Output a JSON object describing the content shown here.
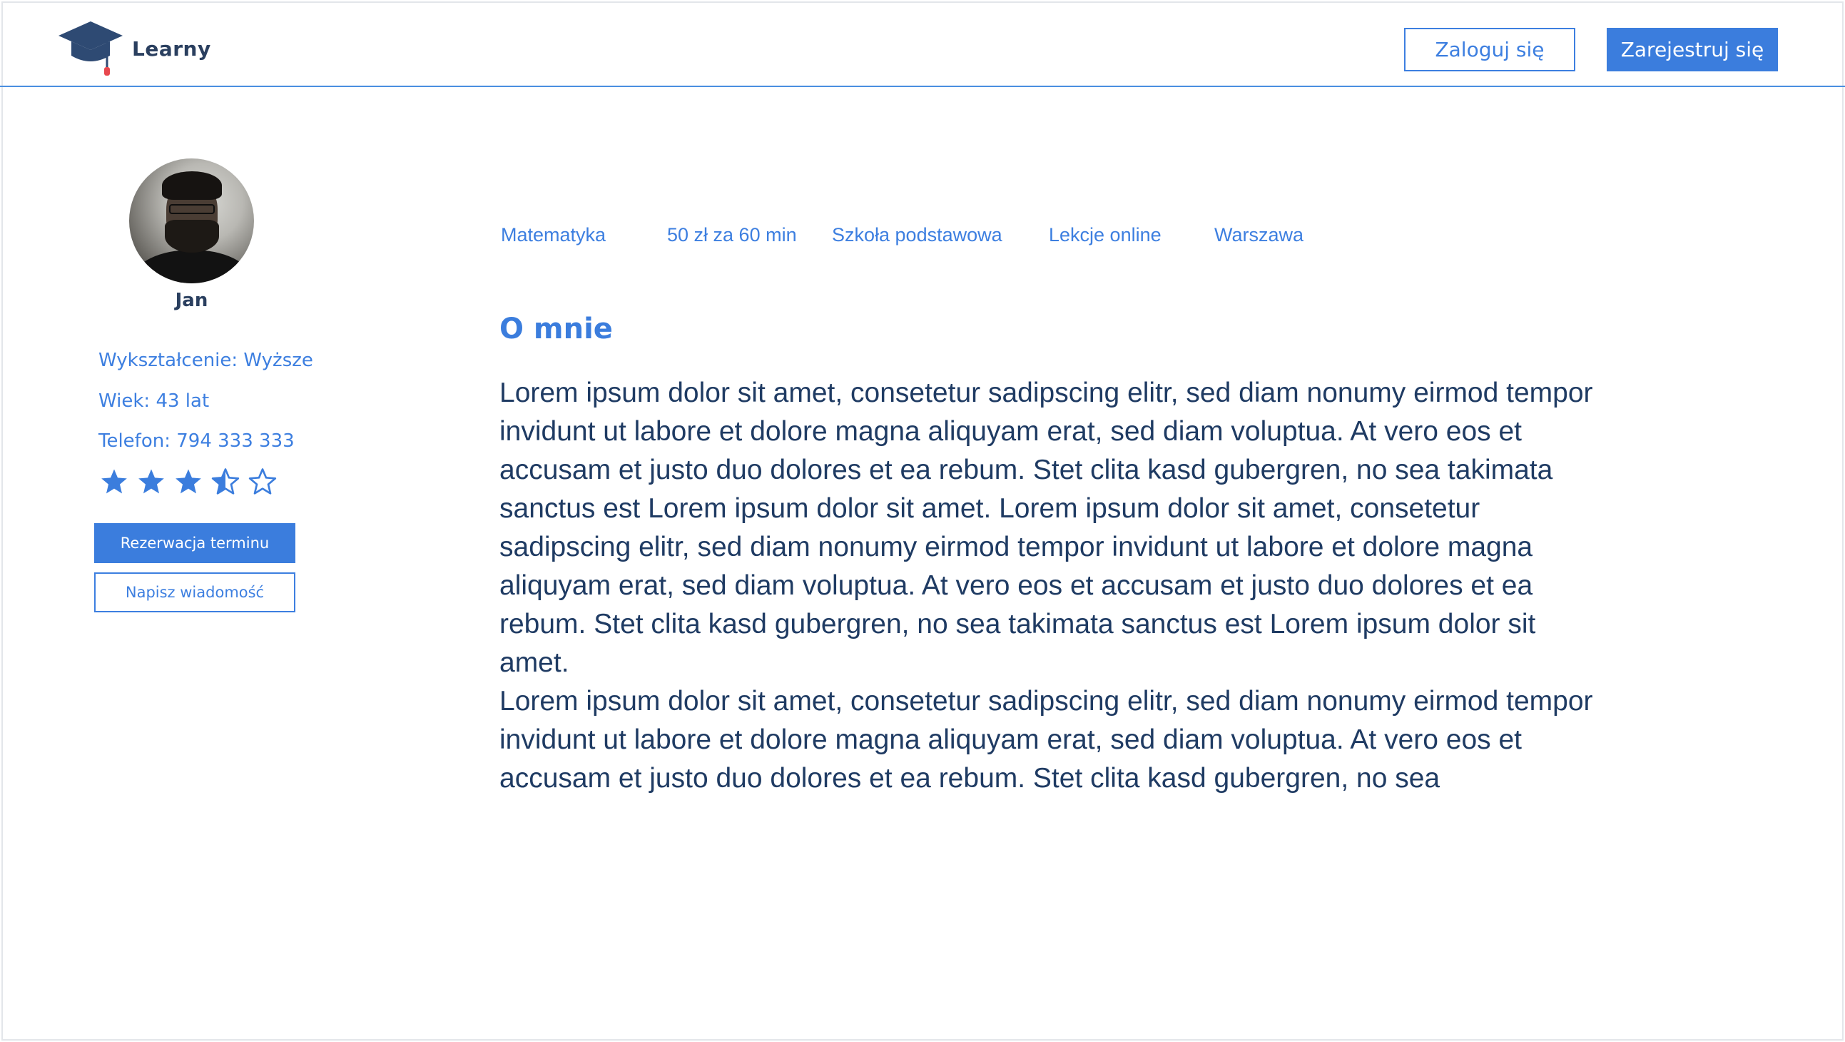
{
  "header": {
    "brand": "Learny",
    "login_label": "Zaloguj się",
    "register_label": "Zarejestruj się"
  },
  "profile": {
    "name": "Jan",
    "education": "Wykształcenie: Wyższe",
    "age": "Wiek: 43 lat",
    "phone": "Telefon: 794 333 333",
    "rating": 3.5,
    "rating_max": 5,
    "reserve_label": "Rezerwacja terminu",
    "message_label": "Napisz wiadomość"
  },
  "tags": [
    "Matematyka",
    "50 zł za 60 min",
    "Szkoła podstawowa",
    "Lekcje online",
    "Warszawa"
  ],
  "about": {
    "title": "O mnie",
    "paragraph1": "Lorem ipsum dolor sit amet, consetetur sadipscing elitr, sed diam nonumy eirmod tempor invidunt ut labore et dolore magna aliquyam erat, sed diam voluptua. At vero eos et accusam et justo duo dolores et ea rebum. Stet clita kasd gubergren, no sea takimata sanctus est Lorem ipsum dolor sit amet. Lorem ipsum dolor sit amet, consetetur sadipscing elitr, sed diam nonumy eirmod tempor invidunt ut labore et dolore magna aliquyam erat, sed diam voluptua. At vero eos et accusam et justo duo dolores et ea rebum. Stet clita kasd gubergren, no sea takimata sanctus est Lorem ipsum dolor sit amet.",
    "paragraph2": "Lorem ipsum dolor sit amet, consetetur sadipscing elitr, sed diam nonumy eirmod tempor invidunt ut labore et dolore magna aliquyam erat, sed diam voluptua. At vero eos et accusam et justo duo dolores et ea rebum. Stet clita kasd gubergren, no sea"
  },
  "colors": {
    "accent": "#3b7ddd",
    "text_dark": "#1f3b63",
    "logo_cap": "#2e4a73",
    "logo_tassel": "#e8484e"
  },
  "icons": {
    "logo": "graduation-cap-icon",
    "star": "star-icon"
  }
}
